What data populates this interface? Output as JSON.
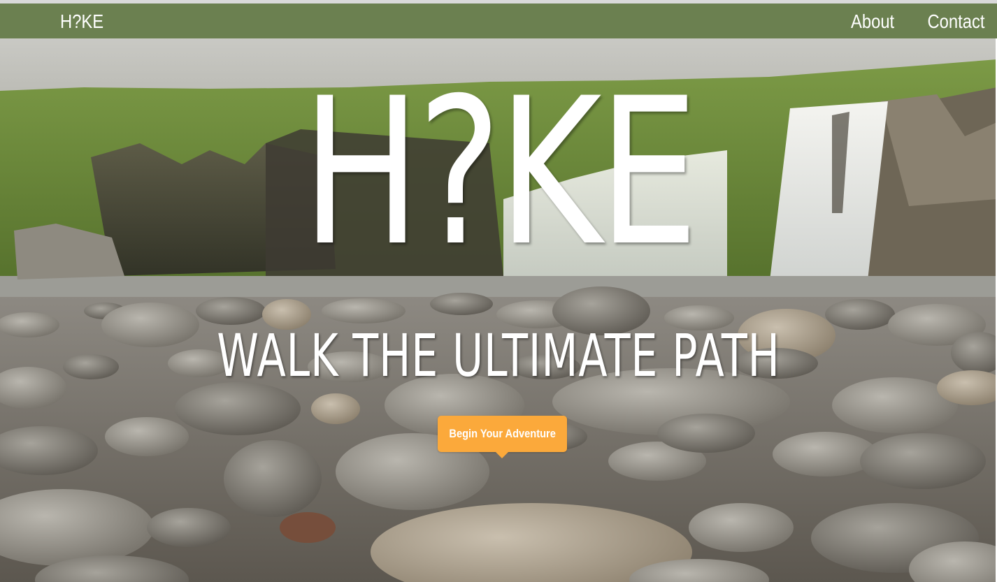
{
  "nav": {
    "brand": "H?KE",
    "links": [
      {
        "label": "About"
      },
      {
        "label": "Contact"
      }
    ]
  },
  "hero": {
    "title": "H?KE",
    "tagline": "WALK THE ULTIMATE PATH",
    "cta_label": "Begin Your Adventure",
    "background": "waterfall-rocky-riverbank-image"
  },
  "colors": {
    "navbar": "#6b8050",
    "cta": "#fba93b",
    "text": "#ffffff"
  }
}
